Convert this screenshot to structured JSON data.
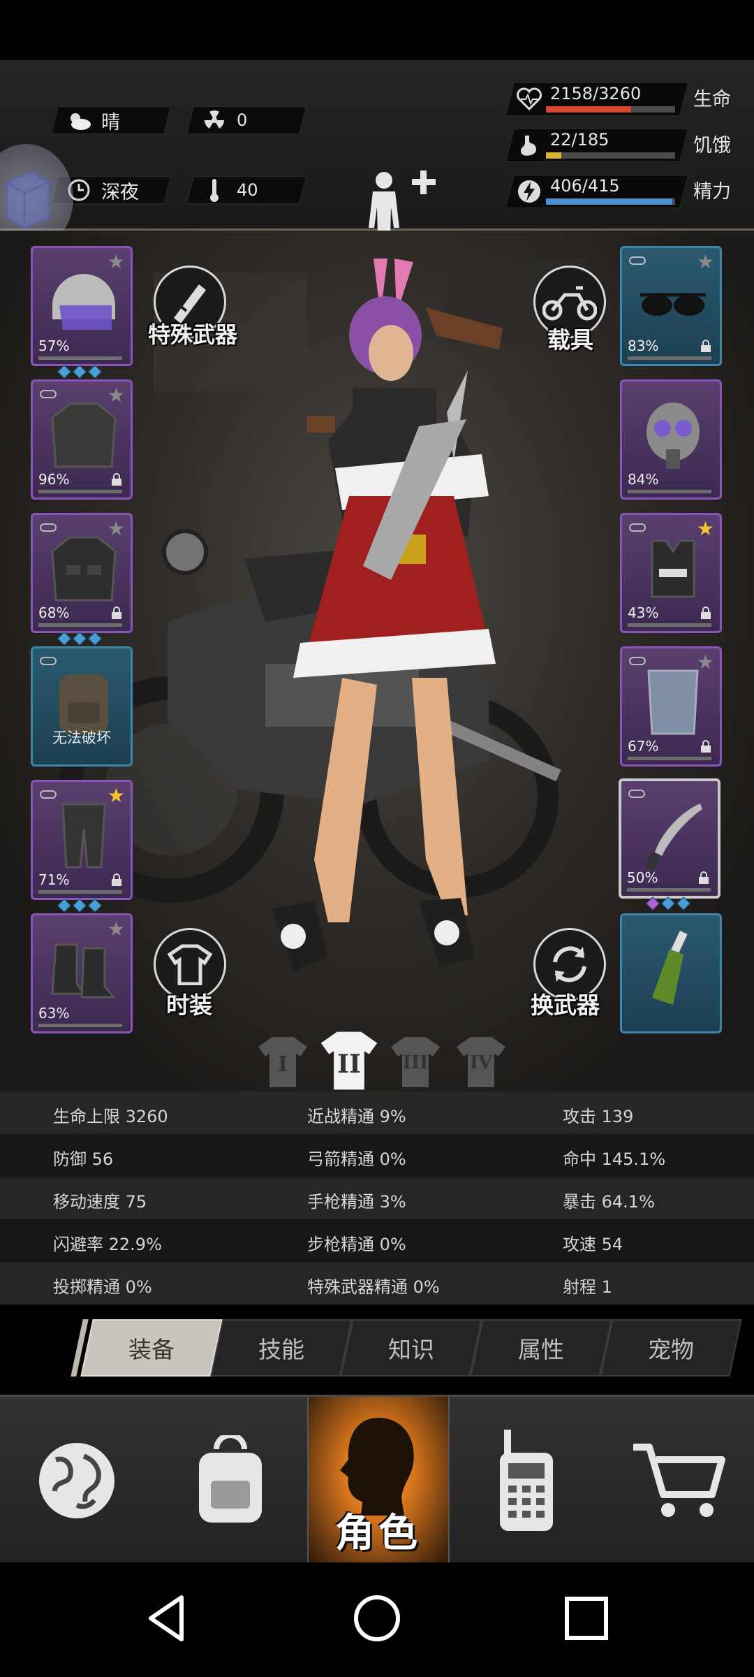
{
  "hud": {
    "weather": "晴",
    "radiation": "0",
    "time_of_day": "深夜",
    "temperature": "40",
    "vitals": [
      {
        "value": "2158/3260",
        "label": "生命",
        "ratio": 0.662,
        "color": "#d9472f"
      },
      {
        "value": "22/185",
        "label": "饥饿",
        "ratio": 0.119,
        "color": "#d8b432"
      },
      {
        "value": "406/415",
        "label": "精力",
        "ratio": 0.978,
        "color": "#4b8fd4"
      }
    ]
  },
  "equipment": {
    "left": [
      {
        "name": "helmet",
        "pct": "57%",
        "gems": 3,
        "star": "gray"
      },
      {
        "name": "jacket",
        "pct": "96%",
        "locked": true,
        "star": "gray"
      },
      {
        "name": "armor-jacket",
        "pct": "68%",
        "locked": true,
        "gems": 3,
        "star": "gray"
      },
      {
        "name": "backpack",
        "text": "无法破坏"
      },
      {
        "name": "pants",
        "pct": "71%",
        "locked": true,
        "gems": 3,
        "star": "gold"
      },
      {
        "name": "boots",
        "pct": "63%",
        "star": "gray"
      }
    ],
    "right": [
      {
        "name": "sunglasses",
        "pct": "83%",
        "locked": true,
        "star": "gray"
      },
      {
        "name": "gas-mask",
        "pct": "84%"
      },
      {
        "name": "police-vest",
        "pct": "43%",
        "locked": true,
        "star": "gold"
      },
      {
        "name": "riot-shield",
        "pct": "67%",
        "locked": true,
        "star": "gray"
      },
      {
        "name": "machete",
        "pct": "50%",
        "locked": true,
        "gems": 3
      },
      {
        "name": "molotov"
      }
    ]
  },
  "buttons": {
    "special_weapon": "特殊武器",
    "vehicle": "载具",
    "fashion": "时装",
    "switch_weapon": "换武器"
  },
  "outfit_tabs": [
    "I",
    "II",
    "III",
    "IV"
  ],
  "outfit_active": 1,
  "stats": [
    [
      "生命上限 3260",
      "近战精通 9%",
      "攻击 139"
    ],
    [
      "防御 56",
      "弓箭精通 0%",
      "命中 145.1%"
    ],
    [
      "移动速度 75",
      "手枪精通 3%",
      "暴击 64.1%"
    ],
    [
      "闪避率 22.9%",
      "步枪精通 0%",
      "攻速 54"
    ],
    [
      "投掷精通 0%",
      "特殊武器精通 0%",
      "射程 1"
    ]
  ],
  "subtabs": [
    "装备",
    "技能",
    "知识",
    "属性",
    "宠物"
  ],
  "subtab_active": 0,
  "bottom_nav": {
    "items": [
      "world-map",
      "backpack",
      "character",
      "radio",
      "shop"
    ],
    "character_label": "角色"
  }
}
